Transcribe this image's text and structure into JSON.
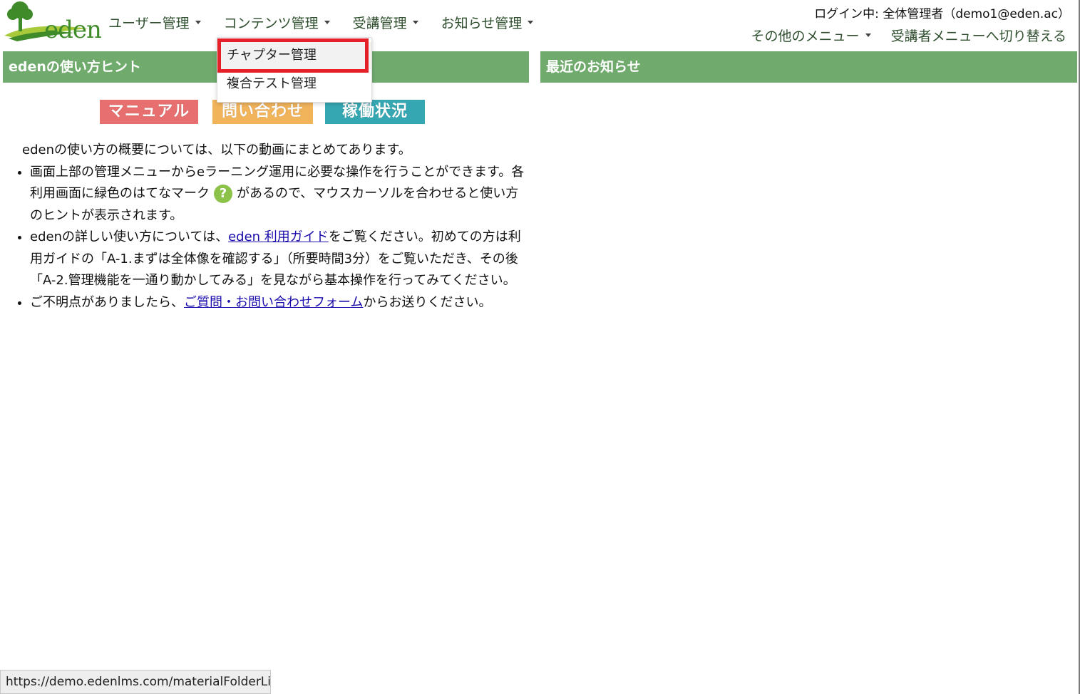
{
  "logo": {
    "text": "eden"
  },
  "nav": {
    "items": [
      {
        "label": "ユーザー管理"
      },
      {
        "label": "コンテンツ管理"
      },
      {
        "label": "受講管理"
      },
      {
        "label": "お知らせ管理"
      }
    ]
  },
  "header": {
    "login_info": "ログイン中: 全体管理者（demo1@eden.ac）",
    "other_menu": "その他のメニュー",
    "switch_menu": "受講者メニューへ切り替える"
  },
  "dropdown": {
    "items": [
      {
        "label": "チャプター管理"
      },
      {
        "label": "複合テスト管理"
      }
    ]
  },
  "left_panel": {
    "title": "edenの使い方ヒント",
    "buttons": {
      "manual": "マニュアル",
      "contact": "問い合わせ",
      "status": "稼働状況"
    },
    "intro": "edenの使い方の概要については、以下の動画にまとめてあります。",
    "bullet1_a": "画面上部の管理メニューからeラーニング運用に必要な操作を行うことができます。各利用画面に緑色のはてなマーク",
    "bullet1_b": "があるので、マウスカーソルを合わせると使い方のヒントが表示されます。",
    "bullet2_a": "edenの詳しい使い方については、",
    "bullet2_link": "eden 利用ガイド",
    "bullet2_b": "をご覧ください。初めての方は利用ガイドの「A-1.まずは全体像を確認する」（所要時間3分）をご覧いただき、その後「A-2.管理機能を一通り動かしてみる」を見ながら基本操作を行ってみてください。",
    "bullet3_a": "ご不明点がありましたら、",
    "bullet3_link": "ご質問・お問い合わせフォーム",
    "bullet3_b": "からお送りください。"
  },
  "right_panel": {
    "title": "最近のお知らせ"
  },
  "statusbar": {
    "url": "https://demo.edenlms.com/materialFolderList"
  },
  "colors": {
    "panel_header": "#70ab6d",
    "highlight": "#e5202a",
    "manual_button": "#e86f6f",
    "contact_button": "#f2b45b",
    "status_button": "#35a7b3",
    "help_icon": "#8cc24a"
  }
}
